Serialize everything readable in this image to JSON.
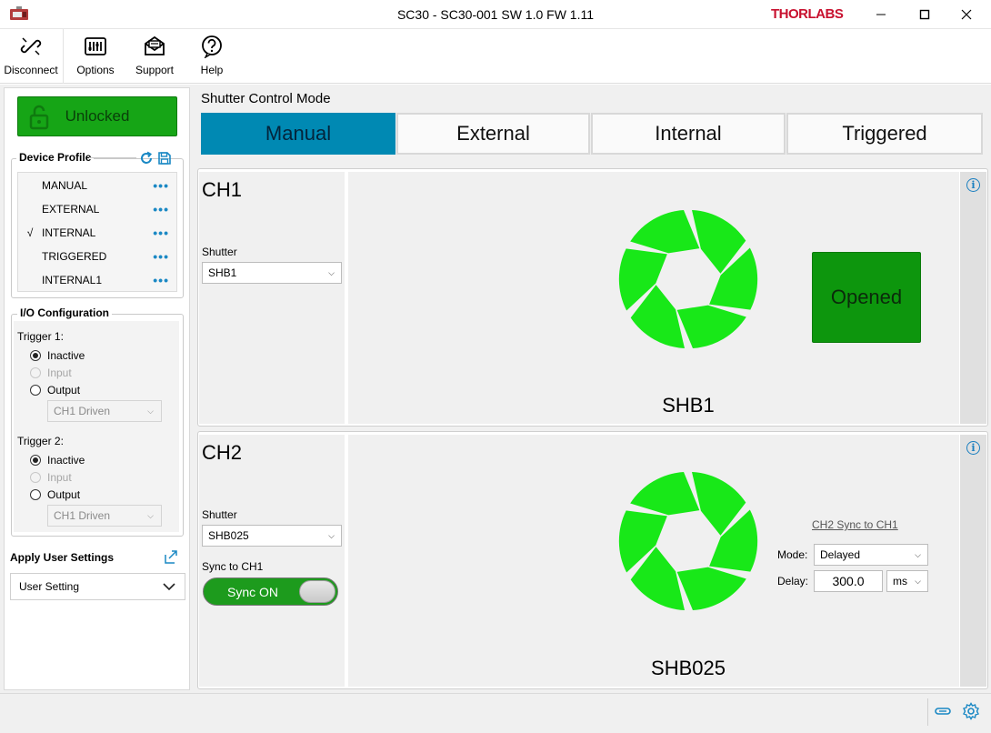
{
  "window": {
    "title": "SC30 - SC30-001 SW 1.0 FW 1.11",
    "brand": "THORLABS",
    "brand_color": "#c8102e"
  },
  "toolbar": {
    "items": [
      {
        "label": "Disconnect",
        "icon": "disconnect-icon"
      },
      {
        "label": "Options",
        "icon": "options-icon"
      },
      {
        "label": "Support",
        "icon": "support-icon"
      },
      {
        "label": "Help",
        "icon": "help-icon"
      }
    ]
  },
  "left": {
    "lock_button": {
      "label": "Unlocked",
      "color": "#16a516"
    },
    "device_profile": {
      "title": "Device Profile",
      "items": [
        {
          "label": "MANUAL",
          "checked": false
        },
        {
          "label": "EXTERNAL",
          "checked": false
        },
        {
          "label": "INTERNAL",
          "checked": true
        },
        {
          "label": "TRIGGERED",
          "checked": false
        },
        {
          "label": "INTERNAL1",
          "checked": false
        }
      ],
      "check_mark": "√",
      "dots": "•••"
    },
    "io": {
      "title": "I/O Configuration",
      "trigger1": {
        "label": "Trigger 1:",
        "options": [
          "Inactive",
          "Input",
          "Output"
        ],
        "selected": "Inactive",
        "driven": "CH1 Driven"
      },
      "trigger2": {
        "label": "Trigger 2:",
        "options": [
          "Inactive",
          "Input",
          "Output"
        ],
        "selected": "Inactive",
        "driven": "CH1 Driven"
      }
    },
    "apply_user_settings": "Apply User Settings",
    "user_setting": "User Setting"
  },
  "main": {
    "mode_label": "Shutter Control Mode",
    "modes": [
      "Manual",
      "External",
      "Internal",
      "Triggered"
    ],
    "active_mode": "Manual",
    "active_color": "#0089b3",
    "ch1": {
      "name": "CH1",
      "shutter_label": "Shutter",
      "shutter_value": "SHB1",
      "device_label": "SHB1",
      "state": "Opened",
      "icon_color": "#18e818"
    },
    "ch2": {
      "name": "CH2",
      "shutter_label": "Shutter",
      "shutter_value": "SHB025",
      "sync_label": "Sync to CH1",
      "sync_toggle": "Sync ON",
      "device_label": "SHB025",
      "sync_link": "CH2 Sync to CH1",
      "mode_label": "Mode:",
      "mode_value": "Delayed",
      "delay_label": "Delay:",
      "delay_value": "300.0",
      "delay_unit": "ms",
      "icon_color": "#18e818"
    }
  }
}
